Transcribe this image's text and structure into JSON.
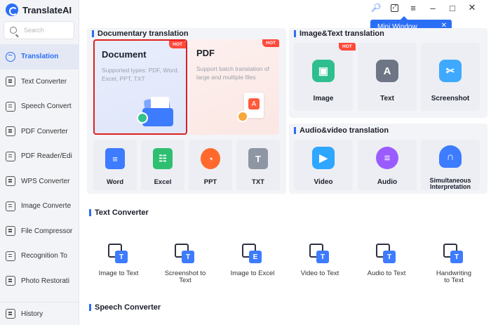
{
  "app": {
    "name": "TranslateAI"
  },
  "search": {
    "placeholder": "Search"
  },
  "sidebar": {
    "items": [
      {
        "label": "Translation",
        "active": true
      },
      {
        "label": "Text Converter"
      },
      {
        "label": "Speech Convert"
      },
      {
        "label": "PDF Converter"
      },
      {
        "label": "PDF Reader/Edi"
      },
      {
        "label": "WPS Converter"
      },
      {
        "label": "Image Converte"
      },
      {
        "label": "File Compressor"
      },
      {
        "label": "Recognition To"
      },
      {
        "label": "Photo Restorati"
      }
    ],
    "history": "History"
  },
  "tooltip": {
    "label": "Mini Window"
  },
  "documentary": {
    "title": "Documentary translation",
    "document": {
      "title": "Document",
      "desc": "Supported types: PDF, Word, Excel, PPT, TXT",
      "badge": "HOT"
    },
    "pdf": {
      "title": "PDF",
      "desc": "Support batch translation of large and multiple files",
      "badge": "HOT"
    },
    "tiles": [
      "Word",
      "Excel",
      "PPT",
      "TXT"
    ]
  },
  "image_text": {
    "title": "Image&Text translation",
    "tiles": [
      "Image",
      "Text",
      "Screenshot"
    ],
    "badge": "HOT"
  },
  "audio_video": {
    "title": "Audio&video translation",
    "tiles": [
      "Video",
      "Audio"
    ],
    "simul_line1": "Simultaneous",
    "simul_line2": "Interpretation"
  },
  "text_converter": {
    "title": "Text Converter",
    "tools": [
      {
        "line1": "Image to Text",
        "line2": ""
      },
      {
        "line1": "Screenshot to",
        "line2": "Text"
      },
      {
        "line1": "Image to Excel",
        "line2": ""
      },
      {
        "line1": "Video to Text",
        "line2": ""
      },
      {
        "line1": "Audio to Text",
        "line2": ""
      },
      {
        "line1": "Handwriting",
        "line2": "to Text"
      }
    ]
  },
  "speech_converter": {
    "title": "Speech Converter"
  },
  "colors": {
    "accent": "#2b6ef6",
    "hot": "#ff4a3a",
    "highlight": "#e02020"
  }
}
